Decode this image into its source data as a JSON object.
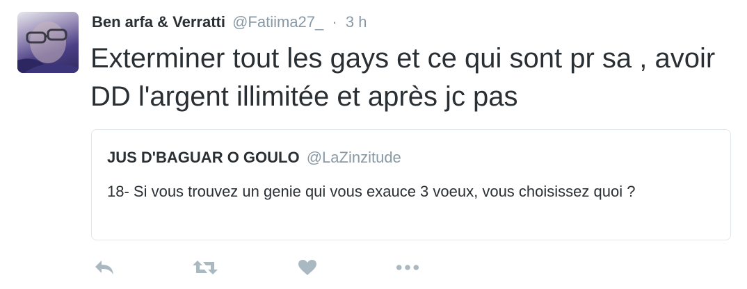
{
  "tweet": {
    "author_name": "Ben arfa & Verratti",
    "handle": "@Fatiima27_",
    "separator": "·",
    "time": "3 h",
    "text": "Exterminer tout les gays et ce qui sont pr sa , avoir DD l'argent illimitée et après jc pas"
  },
  "quoted_tweet": {
    "author_name": "JUS D'BAGUAR O GOULO",
    "handle": "@LaZinzitude",
    "text": "18- Si vous trouvez un genie qui vous exauce 3 voeux, vous choisissez quoi ?"
  },
  "actions": [
    {
      "icon": "reply-icon"
    },
    {
      "icon": "retweet-icon"
    },
    {
      "icon": "like-icon"
    },
    {
      "icon": "more-icon"
    }
  ],
  "colors": {
    "text": "#292f33",
    "secondary": "#8899a6",
    "border": "#e1e8ed",
    "icon": "#aab8c2"
  }
}
